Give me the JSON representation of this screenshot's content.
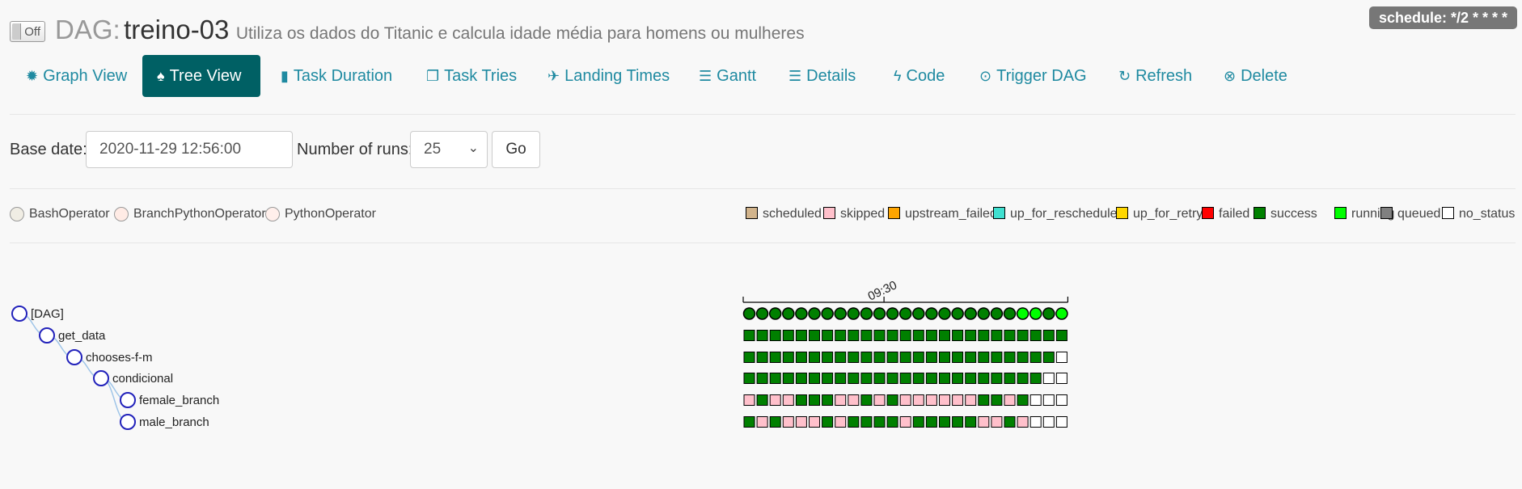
{
  "header": {
    "toggle_label": "Off",
    "dag_prefix": "DAG:",
    "dag_id": "treino-03",
    "description": "Utiliza os dados do Titanic e calcula idade média para homens ou mulheres",
    "schedule": "schedule: */2 * * * *"
  },
  "nav": [
    {
      "label": "Graph View",
      "icon": "graph-icon",
      "glyph": "✹"
    },
    {
      "label": "Tree View",
      "icon": "tree-icon",
      "glyph": "♠",
      "active": true
    },
    {
      "label": "Task Duration",
      "icon": "bar-chart-icon",
      "glyph": "▮"
    },
    {
      "label": "Task Tries",
      "icon": "files-icon",
      "glyph": "❐"
    },
    {
      "label": "Landing Times",
      "icon": "plane-icon",
      "glyph": "✈"
    },
    {
      "label": "Gantt",
      "icon": "gantt-icon",
      "glyph": "☰"
    },
    {
      "label": "Details",
      "icon": "list-icon",
      "glyph": "☰"
    },
    {
      "label": "Code",
      "icon": "flash-icon",
      "glyph": "ϟ"
    },
    {
      "label": "Trigger DAG",
      "icon": "play-circle-icon",
      "glyph": "⊙"
    },
    {
      "label": "Refresh",
      "icon": "refresh-icon",
      "glyph": "↻"
    },
    {
      "label": "Delete",
      "icon": "remove-circle-icon",
      "glyph": "⊗"
    }
  ],
  "form": {
    "base_date_label": "Base date:",
    "base_date_value": "2020-11-29 12:56:00",
    "runs_label": "Number of runs:",
    "runs_value": "25",
    "go_label": "Go"
  },
  "operators": [
    {
      "label": "BashOperator",
      "color": "#f0ede4"
    },
    {
      "label": "BranchPythonOperator",
      "color": "#ffebe5"
    },
    {
      "label": "PythonOperator",
      "color": "#ffefeb"
    }
  ],
  "states": [
    {
      "label": "scheduled",
      "color": "#d2b48c"
    },
    {
      "label": "skipped",
      "color": "#ffc0cb"
    },
    {
      "label": "upstream_failed",
      "color": "#ffa500"
    },
    {
      "label": "up_for_reschedule",
      "color": "#40e0d0"
    },
    {
      "label": "up_for_retry",
      "color": "#ffd700"
    },
    {
      "label": "failed",
      "color": "#ff0000"
    },
    {
      "label": "success",
      "color": "#008000"
    },
    {
      "label": "running",
      "color": "#00ff00"
    },
    {
      "label": "queued",
      "color": "#808080"
    },
    {
      "label": "no_status",
      "color": "#ffffff"
    }
  ],
  "tree": {
    "time_label": "09:30",
    "dag_runs": [
      "success",
      "success",
      "success",
      "success",
      "success",
      "success",
      "success",
      "success",
      "success",
      "success",
      "success",
      "success",
      "success",
      "success",
      "success",
      "success",
      "success",
      "success",
      "success",
      "success",
      "success",
      "running",
      "running",
      "success",
      "running"
    ],
    "tasks": [
      {
        "label": "[DAG]"
      },
      {
        "label": "get_data",
        "states": "SSSSSSSSSSSSSSSSSSSSSSSSS"
      },
      {
        "label": "chooses-f-m",
        "states": "SSSSSSSSSSSSSSSSSSSSSSSSN"
      },
      {
        "label": "condicional",
        "states": "SSSSSSSSSSSSSSSSSSSSSSSNN"
      },
      {
        "label": "female_branch",
        "states": "KSKKSSSKKSKSKKKKKKSSKSNNN"
      },
      {
        "label": "male_branch",
        "states": "SKSKKKSKSSSSKSSSSSKKSKNNN"
      }
    ]
  }
}
